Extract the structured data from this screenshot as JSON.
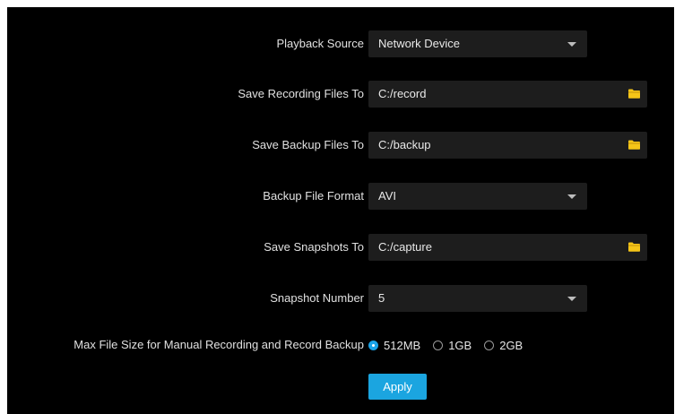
{
  "settings": {
    "playback_source": {
      "label": "Playback Source",
      "value": "Network Device"
    },
    "save_recording": {
      "label": "Save Recording Files To",
      "value": "C:/record"
    },
    "save_backup": {
      "label": "Save Backup Files To",
      "value": "C:/backup"
    },
    "backup_format": {
      "label": "Backup File Format",
      "value": "AVI"
    },
    "save_snapshots": {
      "label": "Save Snapshots To",
      "value": "C:/capture"
    },
    "snapshot_number": {
      "label": "Snapshot Number",
      "value": "5"
    },
    "max_file_size": {
      "label": "Max File Size for Manual Recording and Record Backup",
      "options": [
        "512MB",
        "1GB",
        "2GB"
      ],
      "selected": "512MB"
    }
  },
  "apply_label": "Apply",
  "colors": {
    "background": "#000000",
    "field": "#1d1d1d",
    "accent": "#1ba5e0",
    "folder_icon": "#f5c518"
  },
  "icons": {
    "dropdown": "caret-down-icon",
    "browse": "folder-icon",
    "radio": "radio-icon"
  }
}
